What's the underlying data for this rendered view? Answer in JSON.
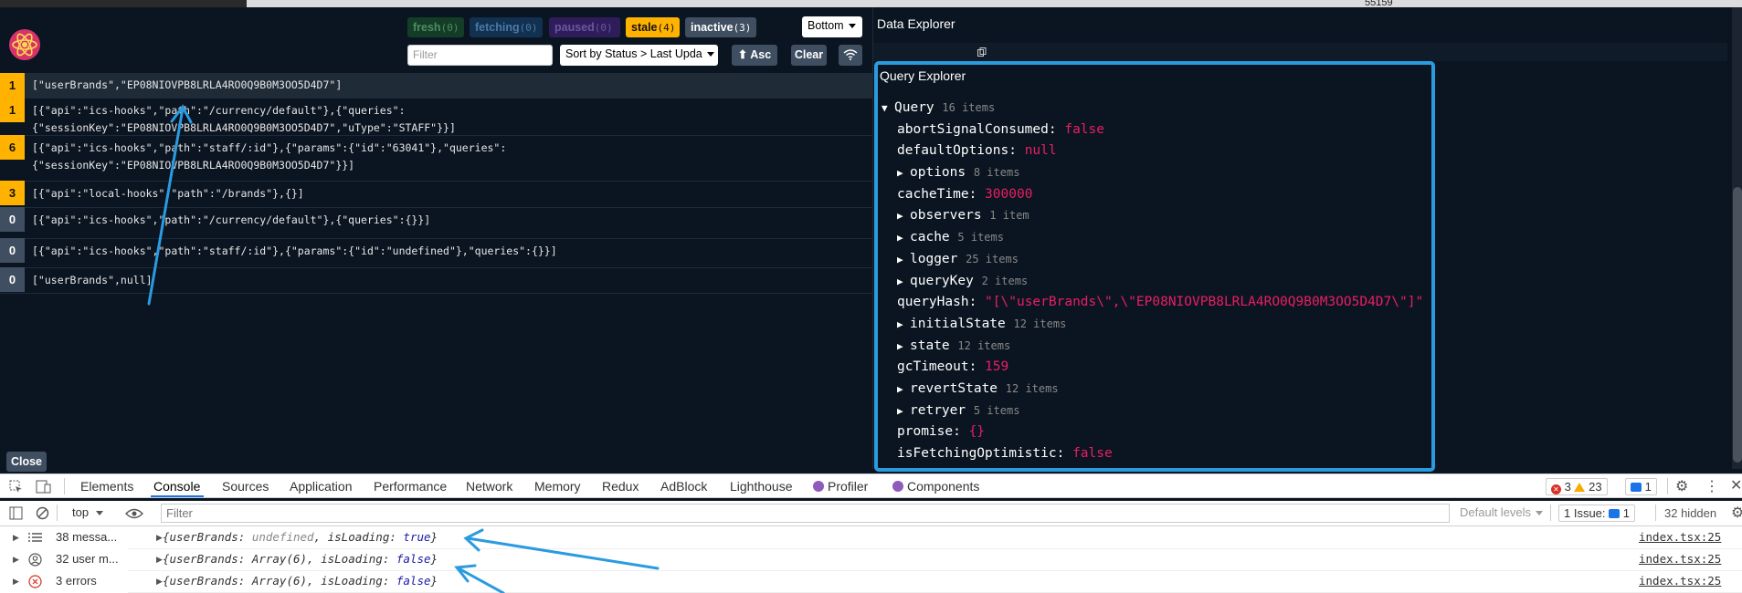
{
  "top_strip": {
    "number": "55159"
  },
  "header": {
    "filters": [
      {
        "label": "fresh",
        "count": "(0)"
      },
      {
        "label": "fetching",
        "count": "(0)"
      },
      {
        "label": "paused",
        "count": "(0)"
      },
      {
        "label": "stale",
        "count": "(4)"
      },
      {
        "label": "inactive",
        "count": "(3)"
      }
    ],
    "filter_placeholder": "Filter",
    "sort_label": "Sort by Status > Last Upda",
    "asc_label": "⬆ Asc",
    "clear_label": "Clear",
    "position_label": "Bottom"
  },
  "queries": [
    {
      "count": "1",
      "status": "stale",
      "key": "[\"userBrands\",\"EP08NIOVPB8LRLA4RO0Q9B0M3OO5D4D7\"]",
      "selected": true
    },
    {
      "count": "1",
      "status": "stale",
      "key": "[{\"api\":\"ics-hooks\",\"path\":\"/currency/default\"},{\"queries\":\n{\"sessionKey\":\"EP08NIOVPB8LRLA4RO0Q9B0M3OO5D4D7\",\"uType\":\"STAFF\"}}]"
    },
    {
      "count": "6",
      "status": "stale",
      "key": "[{\"api\":\"ics-hooks\",\"path\":\"staff/:id\"},{\"params\":{\"id\":\"63041\"},\"queries\":\n{\"sessionKey\":\"EP08NIOVPB8LRLA4RO0Q9B0M3OO5D4D7\"}}]"
    },
    {
      "count": "3",
      "status": "stale",
      "key": "[{\"api\":\"local-hooks\",\"path\":\"/brands\"},{}]"
    },
    {
      "count": "0",
      "status": "inactive",
      "key": "[{\"api\":\"ics-hooks\",\"path\":\"/currency/default\"},{\"queries\":{}}]"
    },
    {
      "count": "0",
      "status": "inactive",
      "key": "[{\"api\":\"ics-hooks\",\"path\":\"staff/:id\"},{\"params\":{\"id\":\"undefined\"},\"queries\":{}}]"
    },
    {
      "count": "0",
      "status": "inactive",
      "key": "[\"userBrands\",null]"
    }
  ],
  "close_label": "Close",
  "data_explorer": {
    "title": "Data Explorer"
  },
  "query_explorer": {
    "title": "Query Explorer",
    "root": {
      "label": "Query",
      "count": "16 items"
    },
    "entries": [
      {
        "key": "abortSignalConsumed:",
        "value": "false",
        "kind": "false"
      },
      {
        "key": "defaultOptions:",
        "value": "null",
        "kind": "null"
      },
      {
        "key": "options",
        "count": "8 items",
        "kind": "group"
      },
      {
        "key": "cacheTime:",
        "value": "300000",
        "kind": "num"
      },
      {
        "key": "observers",
        "count": "1 item",
        "kind": "group"
      },
      {
        "key": "cache",
        "count": "5 items",
        "kind": "group"
      },
      {
        "key": "logger",
        "count": "25 items",
        "kind": "group"
      },
      {
        "key": "queryKey",
        "count": "2 items",
        "kind": "group"
      },
      {
        "key": "queryHash:",
        "value": "\"[\\\"userBrands\\\",\\\"EP08NIOVPB8LRLA4RO0Q9B0M3OO5D4D7\\\"]\"",
        "kind": "str"
      },
      {
        "key": "initialState",
        "count": "12 items",
        "kind": "group"
      },
      {
        "key": "state",
        "count": "12 items",
        "kind": "group"
      },
      {
        "key": "gcTimeout:",
        "value": "159",
        "kind": "num"
      },
      {
        "key": "revertState",
        "count": "12 items",
        "kind": "group"
      },
      {
        "key": "retryer",
        "count": "5 items",
        "kind": "group"
      },
      {
        "key": "promise:",
        "value": "{}",
        "kind": "obj"
      },
      {
        "key": "isFetchingOptimistic:",
        "value": "false",
        "kind": "false"
      }
    ]
  },
  "devtools": {
    "tabs": [
      "Elements",
      "Console",
      "Sources",
      "Application",
      "Performance",
      "Network",
      "Memory",
      "Redux",
      "AdBlock",
      "Lighthouse",
      "Profiler",
      "Components"
    ],
    "errors": "3",
    "warnings": "23",
    "messages": "1",
    "context": "top",
    "filter_placeholder": "Filter",
    "levels": "Default levels",
    "issues_label": "1 Issue:",
    "issues_count": "1",
    "hidden": "32 hidden",
    "sidebar": [
      "38 messa...",
      "32 user m...",
      "3 errors"
    ],
    "logs": [
      {
        "prefix": "{userBrands: ",
        "v1": "undefined",
        "mid": ", isLoading: ",
        "v2": "true",
        "suffix": "}",
        "source": "index.tsx:25"
      },
      {
        "prefix": "{userBrands: Array(6), isLoading: ",
        "v1": "",
        "mid": "",
        "v2": "false",
        "suffix": "}",
        "source": "index.tsx:25"
      },
      {
        "prefix": "{userBrands: Array(6), isLoading: ",
        "v1": "",
        "mid": "",
        "v2": "false",
        "suffix": "}",
        "source": "index.tsx:25"
      }
    ]
  },
  "colors": {
    "stale": "#ffb200",
    "inactive": "#3f4e60",
    "accent": "#2b9be0",
    "value": "#e91e63"
  }
}
